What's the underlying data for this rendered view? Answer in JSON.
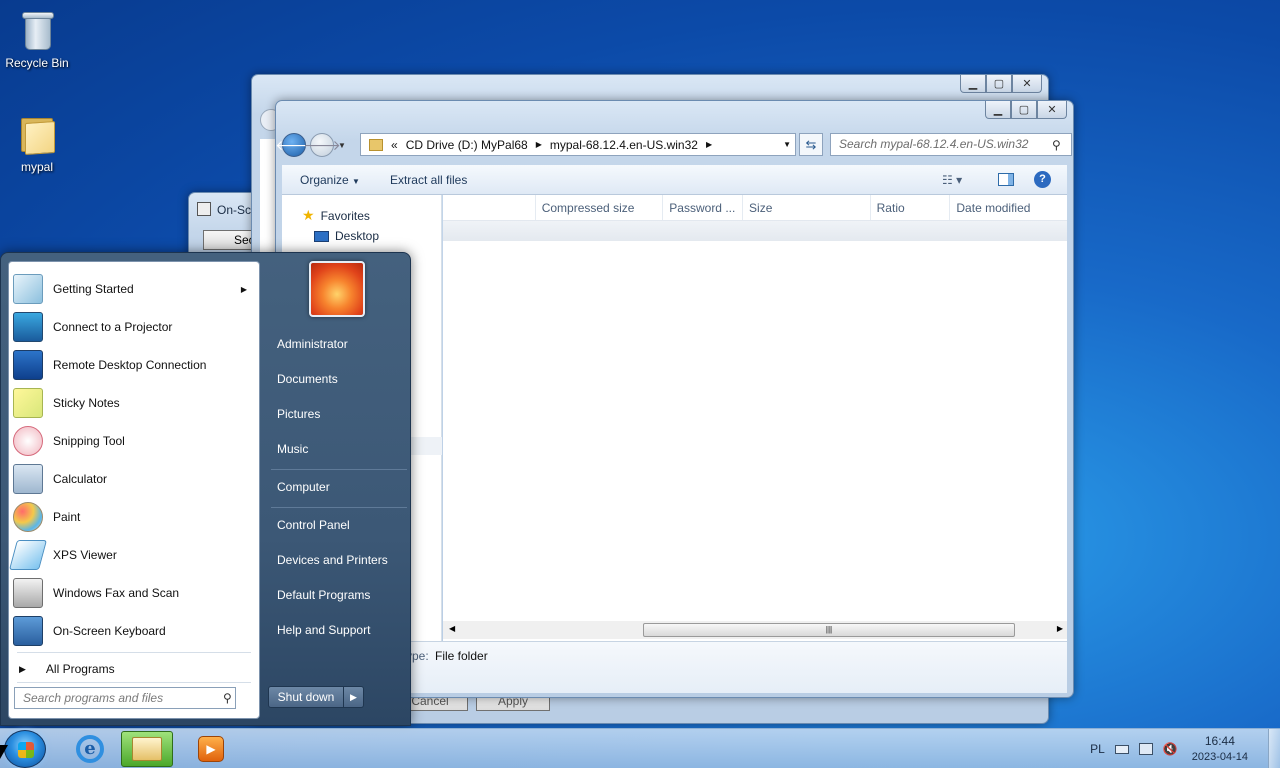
{
  "desktop": {
    "icons": [
      {
        "label": "Recycle Bin",
        "icon": "recycle-bin-icon"
      },
      {
        "label": "mypal",
        "icon": "folder-icon"
      }
    ]
  },
  "back_windows": {
    "osk_title": "On-Sc",
    "osk_button": "Sec",
    "cancel_label": "Cancel",
    "apply_label": "Apply"
  },
  "explorer": {
    "address": {
      "prefix": "«",
      "crumbs": [
        "CD Drive (D:) MyPal68",
        "mypal-68.12.4.en-US.win32"
      ]
    },
    "search_placeholder": "Search mypal-68.12.4.en-US.win32",
    "toolbar": {
      "organize": "Organize",
      "extract": "Extract all files"
    },
    "nav_pane": {
      "favorites": "Favorites",
      "desktop": "Desktop"
    },
    "columns": [
      "Compressed size",
      "Password ...",
      "Size",
      "Ratio",
      "Date modified"
    ],
    "details": {
      "type_label": "ype:",
      "type_value": "File folder"
    }
  },
  "start_menu": {
    "programs": [
      {
        "label": "Getting Started",
        "icon": "getting-started-icon",
        "submenu": true
      },
      {
        "label": "Connect to a Projector",
        "icon": "projector-icon"
      },
      {
        "label": "Remote Desktop Connection",
        "icon": "remote-desktop-icon"
      },
      {
        "label": "Sticky Notes",
        "icon": "sticky-notes-icon"
      },
      {
        "label": "Snipping Tool",
        "icon": "snipping-tool-icon"
      },
      {
        "label": "Calculator",
        "icon": "calculator-icon"
      },
      {
        "label": "Paint",
        "icon": "paint-icon"
      },
      {
        "label": "XPS Viewer",
        "icon": "xps-viewer-icon"
      },
      {
        "label": "Windows Fax and Scan",
        "icon": "fax-scan-icon"
      },
      {
        "label": "On-Screen Keyboard",
        "icon": "keyboard-icon"
      }
    ],
    "all_programs": "All Programs",
    "search_placeholder": "Search programs and files",
    "right_items": [
      "Administrator",
      "Documents",
      "Pictures",
      "Music",
      "Computer",
      "Control Panel",
      "Devices and Printers",
      "Default Programs",
      "Help and Support"
    ],
    "shutdown": "Shut down"
  },
  "taskbar": {
    "language": "PL",
    "time": "16:44",
    "date": "2023-04-14"
  }
}
